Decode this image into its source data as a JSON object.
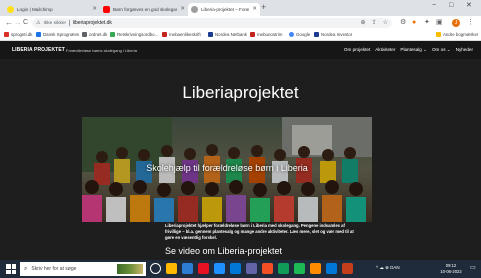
{
  "browser": {
    "tabs": [
      {
        "title": "Login | Mailchimp",
        "fav_color": "#ffe01b",
        "active": false
      },
      {
        "title": "Børn forgæves en god skolegang | Liberia",
        "fav_color": "#ff0000",
        "active": false
      },
      {
        "title": "Liberia-projektet – Foræddreløse",
        "fav_color": "#9e9e9e",
        "active": true
      }
    ],
    "new_tab": "+",
    "window_controls": {
      "minimize": "−",
      "maximize": "□",
      "close": "✕"
    },
    "nav": {
      "back": "←",
      "forward": "→",
      "reload": "C",
      "home": "⌂"
    },
    "address": {
      "security_label": "Ikke sikker",
      "url": "liberiaprojektet.dk"
    },
    "bookmarks": [
      {
        "label": "sprogeti.dk",
        "color": "#d93025"
      },
      {
        "label": "Dansk Sprognævn",
        "color": "#1a73e8"
      },
      {
        "label": "ordnet.dk",
        "color": "#5f6368"
      },
      {
        "label": "Retskrivningsordbo...",
        "color": "#34a853"
      },
      {
        "label": "mebaenlikeskrift",
        "color": "#c5221f"
      },
      {
        "label": "Nordea Netbank",
        "color": "#1a3b8f"
      },
      {
        "label": "mebunostrim",
        "color": "#c5221f"
      },
      {
        "label": "Google",
        "color": "#4285f4"
      },
      {
        "label": "Nordea Investor",
        "color": "#1a3b8f"
      }
    ],
    "other_bookmarks": "Andre bogmærker",
    "profile_initial": "J"
  },
  "site": {
    "logo": "LIBERIA PROJEKTET",
    "tagline": "Foræddreløse børns skolegang i Liberia",
    "nav": [
      "Om projektet",
      "Aktiviteter",
      "Plantesalg ⌄",
      "Om os ⌄",
      "Nyheder"
    ],
    "hero_title": "Liberiaprojektet",
    "hero_caption": "Skolehjælp til forældreløse børn i Liberia",
    "intro": "Liberiaprojektet hjælper forældreløse børn i Liberia med skolegang. Pengene indsamles af frivillige – bl.a. gennem plantesalg og mange andre aktiviteter. Læs mere, slet og vær med til at gøre en væsentlig forskel.",
    "video_link": "Se video om Liberia-projektet"
  },
  "taskbar": {
    "search_placeholder": "Skriv her for at søge",
    "tray_text": "^ ☁ ⊕ DAN",
    "time": "09:12",
    "date": "10-06-2022",
    "apps": [
      "#ffb900",
      "#2d7dd2",
      "#e81123",
      "#1e90ff",
      "#0078d7",
      "#6264a7",
      "#f25022",
      "#0f9d58",
      "#1db954",
      "#ff8c00",
      "#0078d7",
      "#c43e1c"
    ]
  }
}
